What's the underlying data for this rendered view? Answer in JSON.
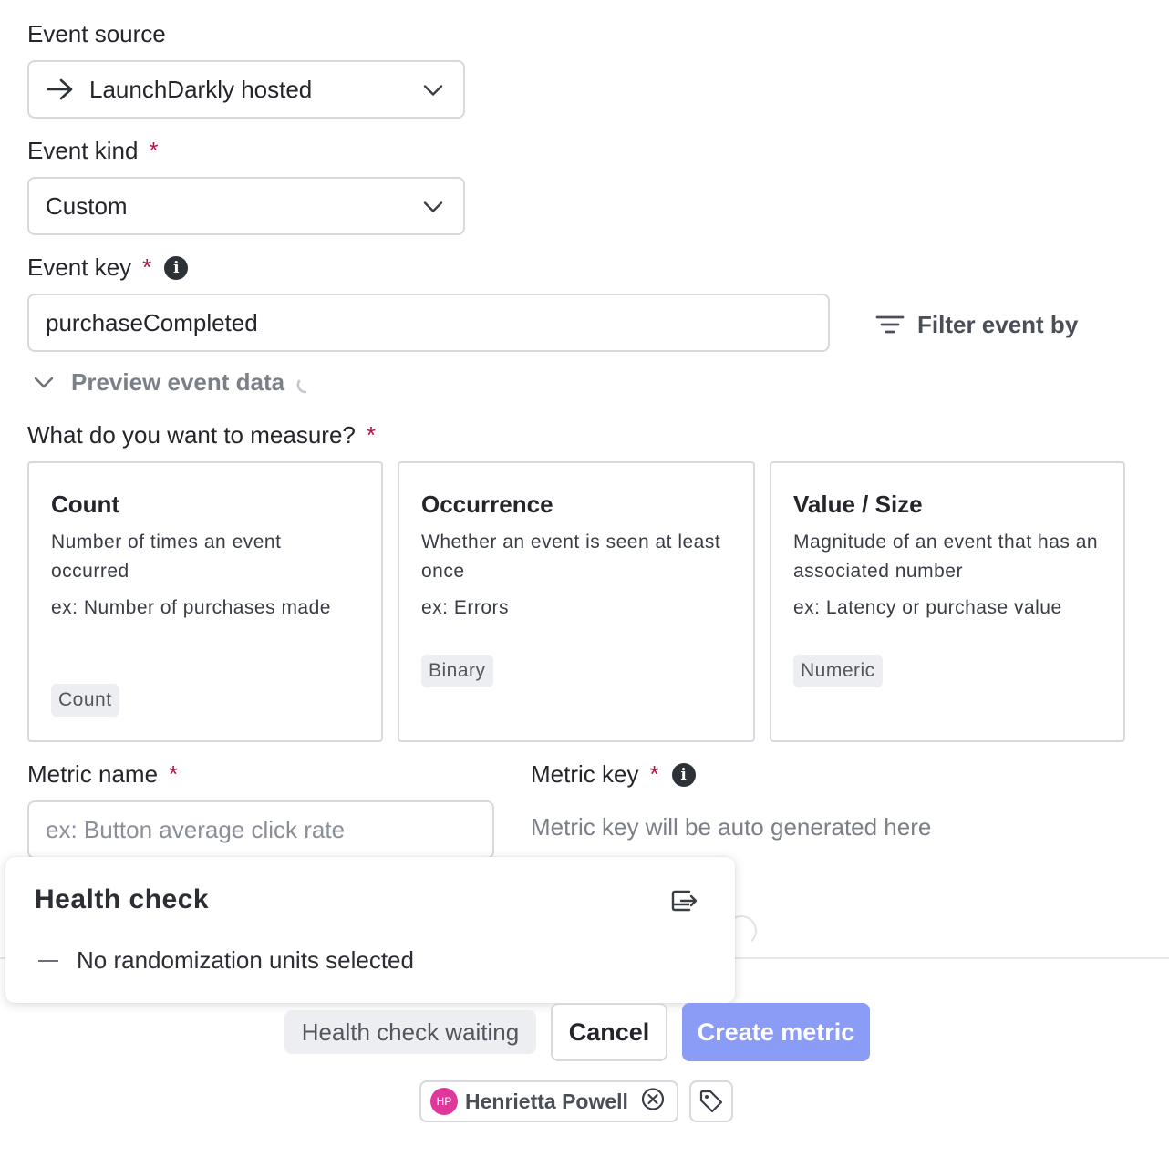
{
  "event_source": {
    "label": "Event source",
    "value": "LaunchDarkly hosted",
    "icon": "arrow-right-icon"
  },
  "event_kind": {
    "label": "Event kind",
    "required_mark": "*",
    "value": "Custom"
  },
  "event_key": {
    "label": "Event key",
    "required_mark": "*",
    "value": "purchaseCompleted",
    "filter_label": "Filter event by"
  },
  "preview": {
    "label": "Preview event data"
  },
  "measure": {
    "label": "What do you want to measure?",
    "required_mark": "*",
    "options": [
      {
        "title": "Count",
        "description": "Number of times an event occurred",
        "example": "ex: Number of purchases made",
        "chip": "Count"
      },
      {
        "title": "Occurrence",
        "description": "Whether an event is seen at least once",
        "example": "ex: Errors",
        "chip": "Binary"
      },
      {
        "title": "Value / Size",
        "description": "Magnitude of an event that has an associated number",
        "example": "ex: Latency or purchase value",
        "chip": "Numeric"
      }
    ]
  },
  "metric_name": {
    "label": "Metric name",
    "required_mark": "*",
    "placeholder": "ex: Button average click rate"
  },
  "metric_key": {
    "label": "Metric key",
    "required_mark": "*",
    "placeholder": "Metric key will be auto generated here"
  },
  "health_check": {
    "title": "Health check",
    "item": "No randomization units selected"
  },
  "footer": {
    "health_status": "Health check waiting",
    "cancel": "Cancel",
    "create": "Create metric"
  },
  "maintainer": {
    "initials": "HP",
    "name": "Henrietta Powell",
    "avatar_color": "#e0379a"
  }
}
